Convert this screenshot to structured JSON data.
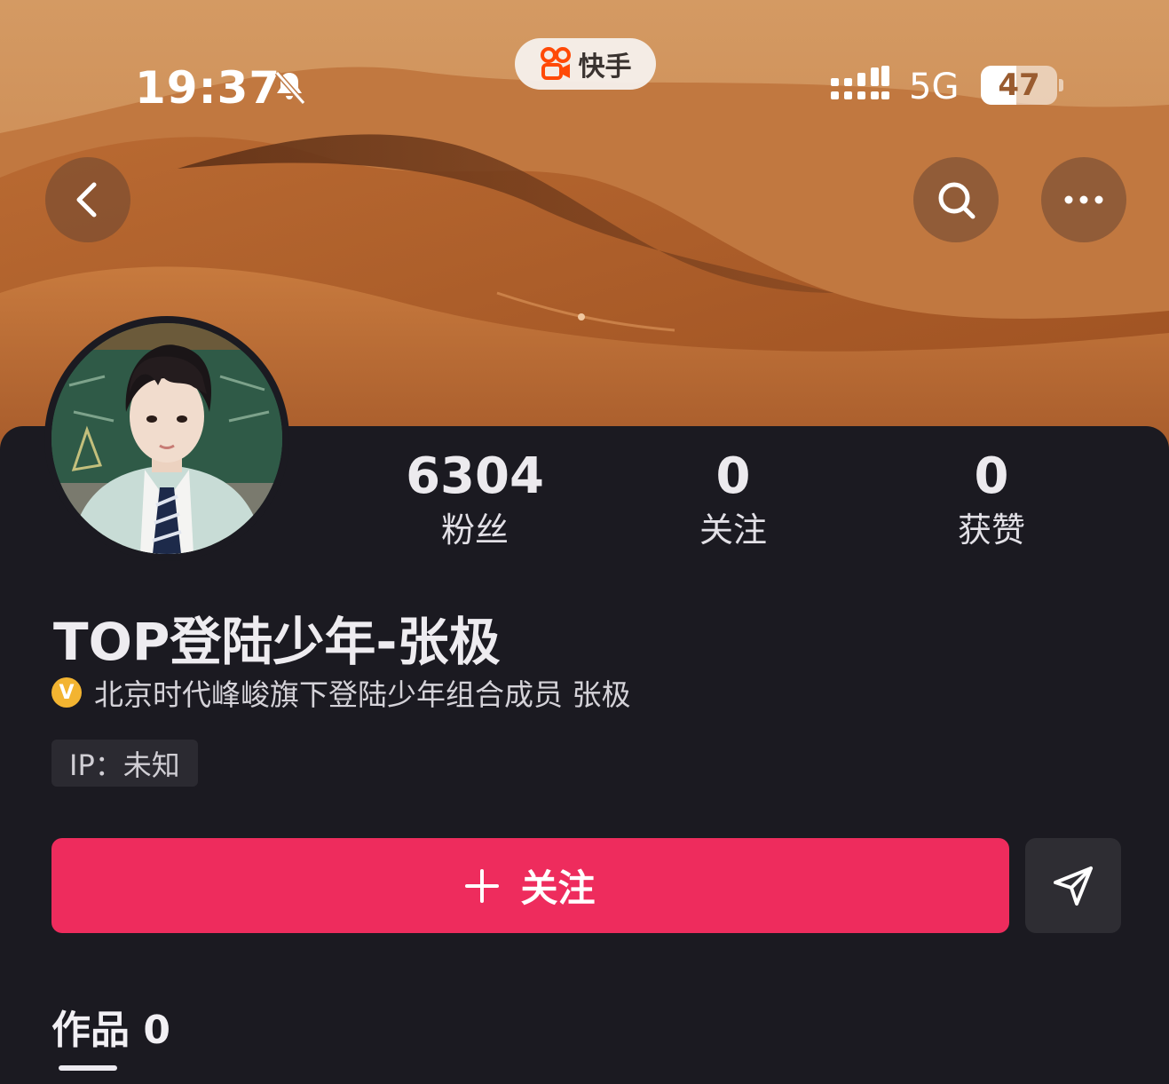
{
  "status_bar": {
    "time": "19:37",
    "network": "5G",
    "battery_level": "47",
    "battery_fraction": 0.47
  },
  "app_badge": {
    "name": "快手",
    "logo_icon": "kuaishou-logo"
  },
  "nav": {
    "back_icon": "chevron-left-icon",
    "search_icon": "search-icon",
    "more_icon": "more-horizontal-icon"
  },
  "stats": [
    {
      "value": "6304",
      "label": "粉丝"
    },
    {
      "value": "0",
      "label": "关注"
    },
    {
      "value": "0",
      "label": "获赞"
    }
  ],
  "profile": {
    "username": "TOP登陆少年-张极",
    "verified_badge": "V",
    "verified_text": "北京时代峰峻旗下登陆少年组合成员 张极",
    "ip_location": "IP：未知"
  },
  "actions": {
    "follow_label": "关注",
    "follow_color": "#ee2c5d",
    "share_icon": "send-icon"
  },
  "tabs": {
    "works": "作品 0"
  }
}
